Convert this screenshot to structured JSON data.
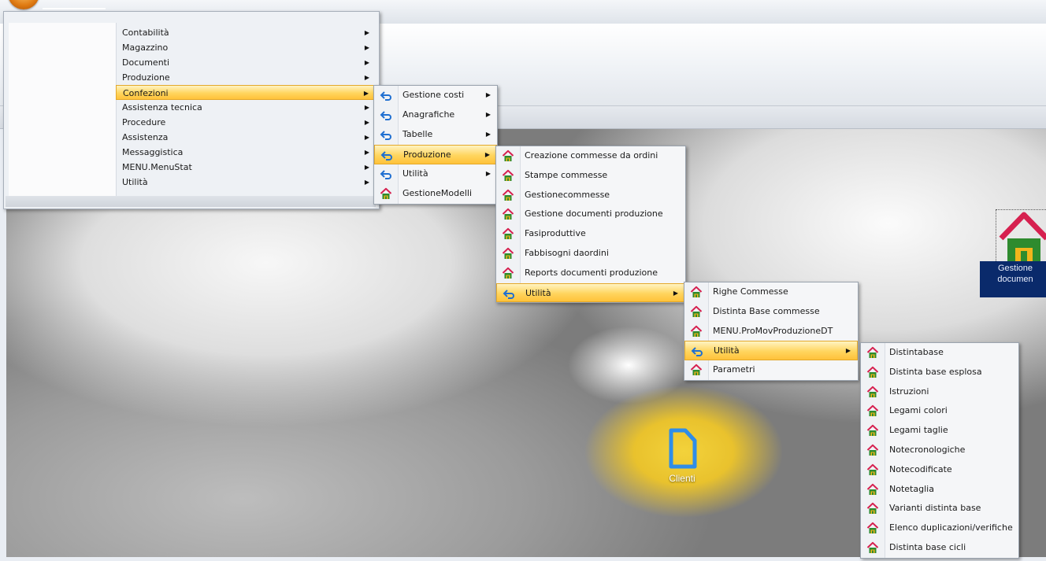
{
  "main_menu": {
    "items": [
      {
        "label": "Contabilità"
      },
      {
        "label": "Magazzino"
      },
      {
        "label": "Documenti"
      },
      {
        "label": "Produzione"
      },
      {
        "label": "Confezioni"
      },
      {
        "label": "Assistenza tecnica"
      },
      {
        "label": "Procedure"
      },
      {
        "label": "Assistenza"
      },
      {
        "label": "Messaggistica"
      },
      {
        "label": "MENU.MenuStat"
      },
      {
        "label": "Utilità"
      }
    ],
    "selected": "Confezioni"
  },
  "confezioni_menu": {
    "items": [
      {
        "label": "Gestione costi",
        "icon": "back-arrow-icon"
      },
      {
        "label": "Anagrafiche",
        "icon": "back-arrow-icon"
      },
      {
        "label": "Tabelle",
        "icon": "back-arrow-icon"
      },
      {
        "label": "Produzione",
        "icon": "back-arrow-icon"
      },
      {
        "label": "Utilità",
        "icon": "back-arrow-icon"
      },
      {
        "label": "GestioneModelli",
        "icon": "home-icon"
      }
    ],
    "selected": "Produzione"
  },
  "produzione_menu": {
    "items": [
      {
        "label": "Creazione commesse da ordini",
        "icon": "home-icon"
      },
      {
        "label": "Stampe commesse",
        "icon": "home-icon"
      },
      {
        "label": "Gestionecommesse",
        "icon": "home-icon"
      },
      {
        "label": "Gestione documenti produzione",
        "icon": "home-icon"
      },
      {
        "label": "Fasiproduttive",
        "icon": "home-icon"
      },
      {
        "label": "Fabbisogni daordini",
        "icon": "home-icon"
      },
      {
        "label": "Reports documenti produzione",
        "icon": "home-icon"
      },
      {
        "label": "Utilità",
        "icon": "back-arrow-icon"
      }
    ],
    "selected": "Utilità"
  },
  "utilita1_menu": {
    "items": [
      {
        "label": "Righe Commesse",
        "icon": "home-icon"
      },
      {
        "label": "Distinta Base commesse",
        "icon": "home-icon"
      },
      {
        "label": "MENU.ProMovProduzioneDT",
        "icon": "home-icon"
      },
      {
        "label": "Utilità",
        "icon": "back-arrow-icon"
      },
      {
        "label": "Parametri",
        "icon": "home-icon"
      }
    ],
    "selected": "Utilità"
  },
  "utilita2_menu": {
    "items": [
      {
        "label": "Distintabase",
        "icon": "home-icon"
      },
      {
        "label": "Distinta base esplosa",
        "icon": "home-icon"
      },
      {
        "label": "Istruzioni",
        "icon": "home-icon"
      },
      {
        "label": "Legami colori",
        "icon": "home-icon"
      },
      {
        "label": "Legami taglie",
        "icon": "home-icon"
      },
      {
        "label": "Notecronologiche",
        "icon": "home-icon"
      },
      {
        "label": "Notecodificate",
        "icon": "home-icon"
      },
      {
        "label": "Notetaglia",
        "icon": "home-icon"
      },
      {
        "label": "Varianti distinta base",
        "icon": "home-icon"
      },
      {
        "label": "Elenco duplicazioni/verifiche",
        "icon": "home-icon"
      },
      {
        "label": "Distinta base cicli",
        "icon": "home-icon"
      }
    ]
  },
  "desktop": {
    "clienti_label": "Clienti",
    "gestione_label_line1": "Gestione",
    "gestione_label_line2": "documen"
  },
  "colors": {
    "highlight": "#ffd55e",
    "arrow_icon": "#1f6fd1",
    "home_roof": "#d6204f",
    "home_body": "#2e8b2e",
    "home_door": "#f2b51c"
  }
}
